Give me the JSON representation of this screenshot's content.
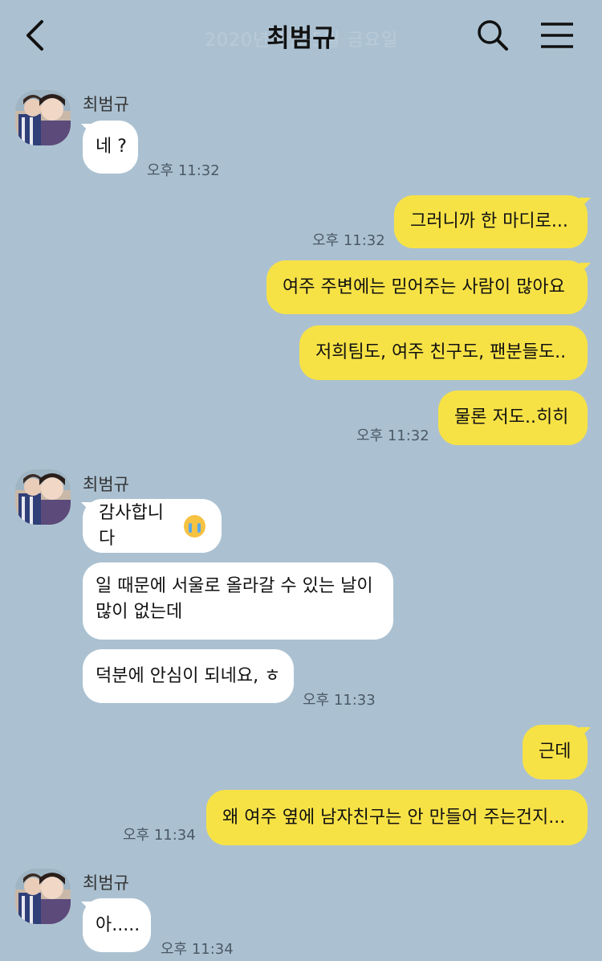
{
  "header": {
    "title": "최범규",
    "ghost_text": "2020년 6월 5일 금요일"
  },
  "messages": {
    "g1": {
      "sender": "최범규",
      "m1": "네 ?",
      "t1": "오후 11:32"
    },
    "o1": {
      "m1": "그러니까 한 마디로...",
      "t1": "오후 11:32",
      "m2": "여주 주변에는 믿어주는 사람이 많아요",
      "m3": "저희팀도, 여주 친구도, 팬분들도..",
      "m4": "물론 저도..히히",
      "t4": "오후 11:32"
    },
    "g2": {
      "sender": "최범규",
      "m1": "감사합니다",
      "m1_emoji": "loudly-crying-face-emoji",
      "m2_line1": "일 때문에 서울로 올라갈 수 있는 날이",
      "m2_line2": "많이 없는데",
      "m3": "덕분에 안심이 되네요, ㅎ",
      "t3": "오후 11:33"
    },
    "o2": {
      "m1": "근데",
      "m2": "왜 여주 옆에 남자친구는 안 만들어 주는건지...",
      "t2": "오후 11:34"
    },
    "g3": {
      "sender": "최범규",
      "m1": "아.....",
      "t1": "오후 11:34"
    }
  },
  "colors": {
    "background": "#abc1d1",
    "incoming_bubble": "#ffffff",
    "outgoing_bubble": "#f7e246"
  }
}
